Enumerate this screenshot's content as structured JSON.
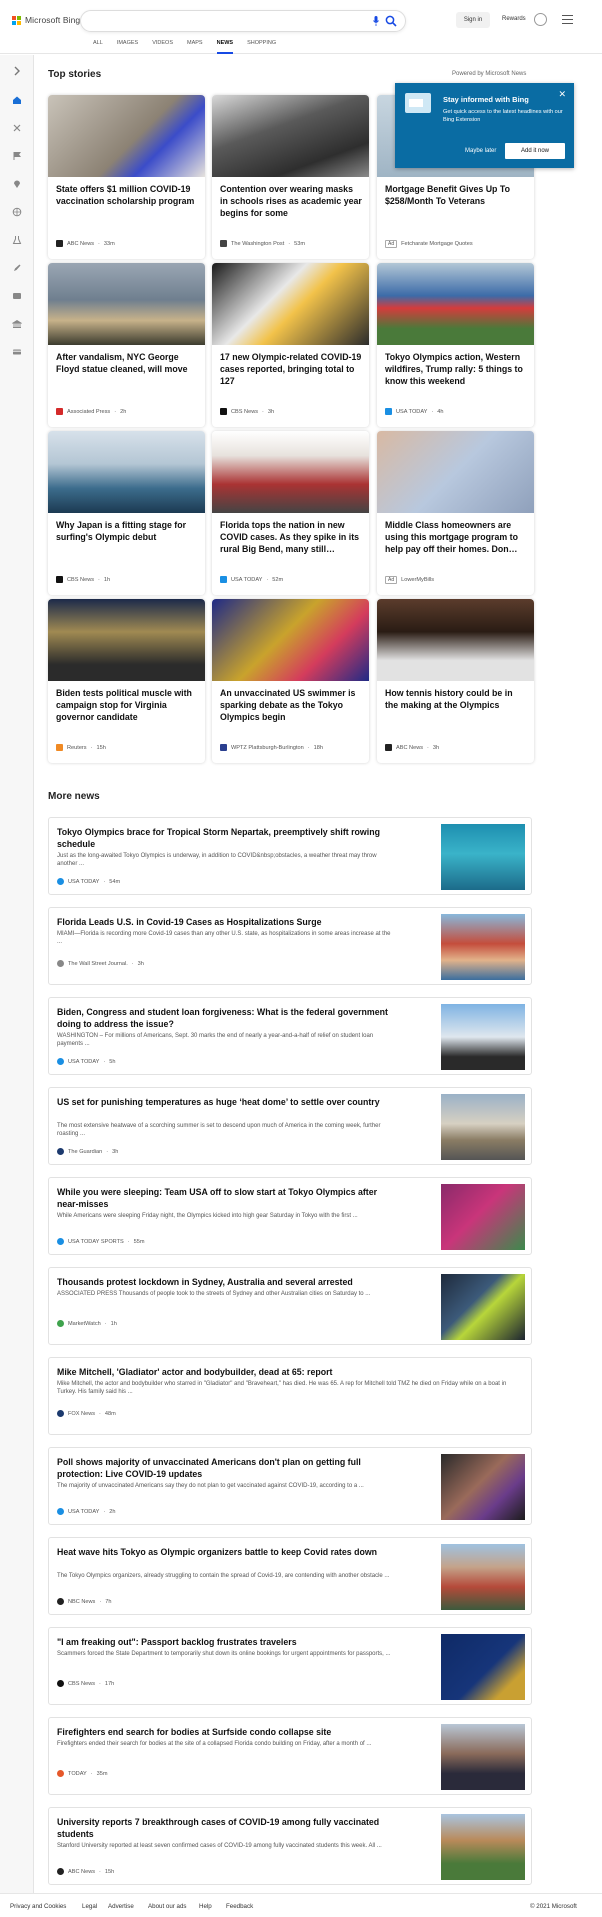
{
  "header": {
    "brand": "Microsoft Bing",
    "brand_colors": [
      "#f25022",
      "#7fba00",
      "#00a4ef",
      "#ffb900"
    ],
    "search_value": "",
    "signin_label": "Sign in",
    "rewards_label": "Rewards",
    "icons": [
      "microphone-icon",
      "search-icon",
      "rewards-trophy-icon",
      "hamburger-menu-icon"
    ]
  },
  "nav": {
    "tabs": [
      {
        "label": "ALL"
      },
      {
        "label": "IMAGES"
      },
      {
        "label": "VIDEOS"
      },
      {
        "label": "MAPS"
      },
      {
        "label": "NEWS",
        "active": true
      },
      {
        "label": "SHOPPING"
      }
    ],
    "accent": "#174ae4"
  },
  "sidebar": {
    "icons": [
      "expand-arrow-icon",
      "home-icon",
      "sports-icon",
      "flag-icon",
      "location-icon",
      "globe-icon",
      "science-icon",
      "rocket-icon",
      "tv-icon",
      "bank-icon",
      "card-icon"
    ]
  },
  "top_stories": {
    "title": "Top stories",
    "powered_by": "Powered by Microsoft News",
    "cards": [
      {
        "title": "State offers $1 million COVID-19 vaccination scholarship program",
        "source": "ABC News",
        "age": "33m",
        "ad": false,
        "fav_color": "#222"
      },
      {
        "title": "Contention over wearing masks in schools rises as academic year begins for some",
        "source": "The Washington Post",
        "age": "53m",
        "ad": false,
        "fav_color": "#444"
      },
      {
        "title": "Mortgage Benefit Gives Up To $258/Month To Veterans",
        "source": "Fetcharate Mortgage Quotes",
        "age": "",
        "ad": true,
        "fav_color": "#fff"
      },
      {
        "title": "After vandalism, NYC George Floyd statue cleaned, will move",
        "source": "Associated Press",
        "age": "2h",
        "ad": false,
        "fav_color": "#d42a2a"
      },
      {
        "title": "17 new Olympic-related COVID-19 cases reported, bringing total to 127",
        "source": "CBS News",
        "age": "3h",
        "ad": false,
        "fav_color": "#111"
      },
      {
        "title": "Tokyo Olympics action, Western wildfires, Trump rally: 5 things to know this weekend",
        "source": "USA TODAY",
        "age": "4h",
        "ad": false,
        "fav_color": "#1a8fe3"
      },
      {
        "title": "Why Japan is a fitting stage for surfing's Olympic debut",
        "source": "CBS News",
        "age": "1h",
        "ad": false,
        "fav_color": "#111"
      },
      {
        "title": "Florida tops the nation in new COVID cases. As they spike in its rural Big Bend, many still…",
        "source": "USA TODAY",
        "age": "52m",
        "ad": false,
        "fav_color": "#1a8fe3"
      },
      {
        "title": "Middle Class homeowners are using this mortgage program to help pay off their homes. Don…",
        "source": "LowerMyBills",
        "age": "",
        "ad": true,
        "fav_color": "#fff"
      },
      {
        "title": "Biden tests political muscle with campaign stop for Virginia governor candidate",
        "source": "Reuters",
        "age": "15h",
        "ad": false,
        "fav_color": "#f08a24"
      },
      {
        "title": "An unvaccinated US swimmer is sparking debate as the Tokyo Olympics begin",
        "source": "WPTZ Plattsburgh-Burlington",
        "age": "18h",
        "ad": false,
        "fav_color": "#2a3f8f"
      },
      {
        "title": "How tennis history could be in the making at the Olympics",
        "source": "ABC News",
        "age": "3h",
        "ad": false,
        "fav_color": "#222"
      }
    ]
  },
  "popup": {
    "title": "Stay informed with Bing",
    "text": "Get quick access to the latest headlines with our Bing Extension",
    "later_label": "Maybe later",
    "install_label": "Add it now",
    "bg_color": "#0a6ca3"
  },
  "more_news": {
    "title": "More news",
    "items": [
      {
        "title": "Tokyo Olympics brace for Tropical Storm Nepartak, preemptively shift rowing schedule",
        "snippet": "Just as the long-awaited Tokyo Olympics is underway, in addition to COVID&nbsp;obstacles, a weather threat may throw another ...",
        "source": "USA TODAY",
        "age": "54m",
        "fav_color": "#1a8fe3"
      },
      {
        "title": "Florida Leads U.S. in Covid-19 Cases as Hospitalizations Surge",
        "snippet": "MIAMI—Florida is recording more Covid-19 cases than any other U.S. state, as hospitalizations in some areas increase at the ...",
        "source": "The Wall Street Journal.",
        "age": "3h",
        "fav_color": "#888"
      },
      {
        "title": "Biden, Congress and student loan forgiveness: What is the federal government doing to address the issue?",
        "snippet": "WASHINGTON – For millions of Americans, Sept. 30 marks the end of nearly a year-and-a-half of relief on student loan payments ...",
        "source": "USA TODAY",
        "age": "5h",
        "fav_color": "#1a8fe3"
      },
      {
        "title": "US set for punishing temperatures as huge ‘heat dome’ to settle over country",
        "snippet": "The most extensive heatwave of a scorching summer is set to descend upon much of America in the coming week, further roasting ...",
        "source": "The Guardian",
        "age": "3h",
        "fav_color": "#1c3a6e"
      },
      {
        "title": "While you were sleeping: Team USA off to slow start at Tokyo Olympics after near-misses",
        "snippet": "While Americans were sleeping Friday night, the Olympics kicked into high gear Saturday in Tokyo with the first ...",
        "source": "USA TODAY SPORTS",
        "age": "55m",
        "fav_color": "#1a8fe3"
      },
      {
        "title": "Thousands protest lockdown in Sydney, Australia and several arrested",
        "snippet": "ASSOCIATED PRESS Thousands of people took to the streets of Sydney and other Australian cities on Saturday to ...",
        "source": "MarketWatch",
        "age": "1h",
        "fav_color": "#3fa34d"
      },
      {
        "title": "Mike Mitchell, 'Gladiator' actor and bodybuilder, dead at 65: report",
        "snippet": "Mike Mitchell, the actor and bodybuilder who starred in \"Gladiator\" and \"Braveheart,\" has died. He was 65. A rep for Mitchell told TMZ he died on Friday while on a boat in Turkey. His family said his ...",
        "source": "FOX News",
        "age": "48m",
        "fav_color": "#1c3a6e"
      },
      {
        "title": "Poll shows majority of unvaccinated Americans don't plan on getting full protection: Live COVID-19 updates",
        "snippet": "The majority of unvaccinated Americans say they do not plan to get vaccinated against COVID-19, according to a ...",
        "source": "USA TODAY",
        "age": "2h",
        "fav_color": "#1a8fe3"
      },
      {
        "title": "Heat wave hits Tokyo as Olympic organizers battle to keep Covid rates down",
        "snippet": "The Tokyo Olympics organizers, already struggling to contain the spread of Covid-19, are contending with another obstacle ...",
        "source": "NBC News",
        "age": "7h",
        "fav_color": "#222"
      },
      {
        "title": "\"I am freaking out\": Passport backlog frustrates travelers",
        "snippet": "Scammers forced the State Department to temporarily shut down its online bookings for urgent appointments for passports, ...",
        "source": "CBS News",
        "age": "17h",
        "fav_color": "#111"
      },
      {
        "title": "Firefighters end search for bodies at Surfside condo collapse site",
        "snippet": "Firefighters ended their search for bodies at the site of a collapsed Florida condo building on Friday, after a month of ...",
        "source": "TODAY",
        "age": "35m",
        "fav_color": "#e6582a"
      },
      {
        "title": "University reports 7 breakthrough cases of COVID-19 among fully vaccinated students",
        "snippet": "Stanford University reported at least seven confirmed cases of COVID-19 among fully vaccinated students this week. All ...",
        "source": "ABC News",
        "age": "15h",
        "fav_color": "#222"
      }
    ]
  },
  "footer": {
    "links": [
      "Privacy and Cookies",
      "Legal",
      "Advertise",
      "About our ads",
      "Help",
      "Feedback"
    ],
    "copyright": "© 2021 Microsoft"
  }
}
